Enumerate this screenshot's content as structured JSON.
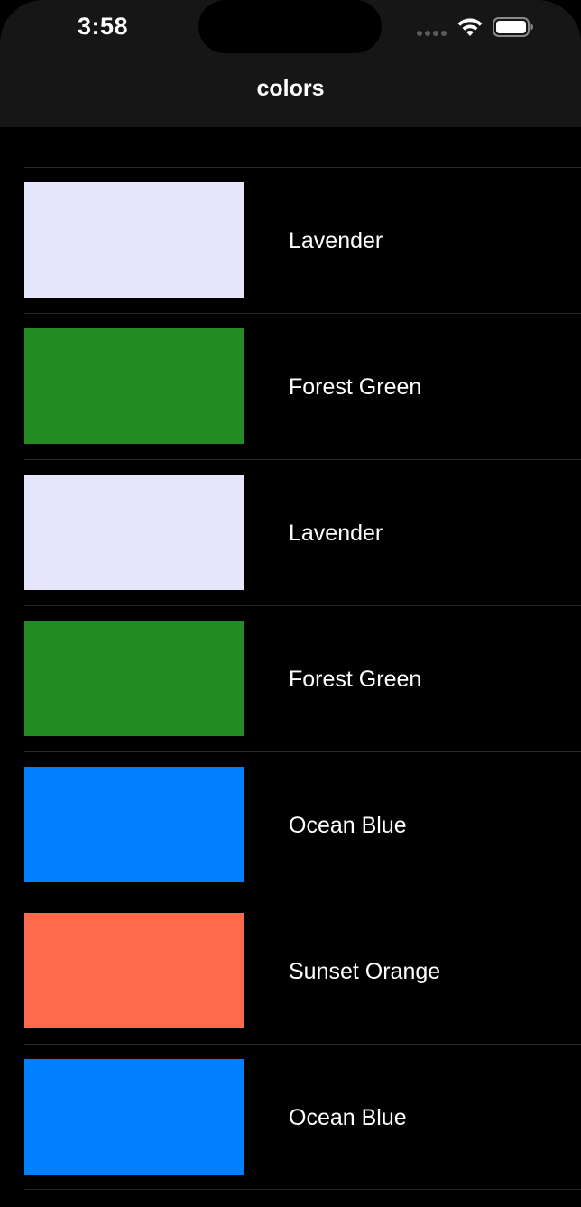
{
  "status_bar": {
    "time": "3:58",
    "signal_icon": "signal-dots-icon",
    "wifi_icon": "wifi-icon",
    "battery_icon": "battery-icon"
  },
  "nav": {
    "title": "colors"
  },
  "colors": [
    {
      "name": "Lavender",
      "hex": "#E6E6FA"
    },
    {
      "name": "Forest Green",
      "hex": "#228B22"
    },
    {
      "name": "Lavender",
      "hex": "#E6E6FA"
    },
    {
      "name": "Forest Green",
      "hex": "#228B22"
    },
    {
      "name": "Ocean Blue",
      "hex": "#007FFF"
    },
    {
      "name": "Sunset Orange",
      "hex": "#FF6A4D"
    },
    {
      "name": "Ocean Blue",
      "hex": "#007FFF"
    }
  ],
  "theme": {
    "background": "#000000",
    "header_background": "#161616",
    "separator": "#2A2A2A",
    "text": "#FFFFFF"
  }
}
